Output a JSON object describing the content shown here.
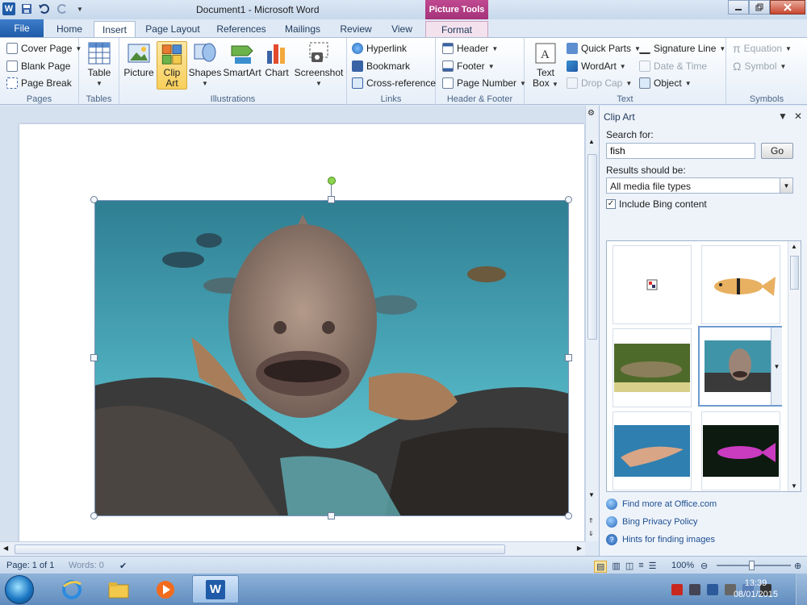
{
  "window": {
    "title": "Document1  -  Microsoft Word",
    "contextual_tab_group": "Picture Tools"
  },
  "tabs": [
    "File",
    "Home",
    "Insert",
    "Page Layout",
    "References",
    "Mailings",
    "Review",
    "View",
    "Format"
  ],
  "active_tab": "Insert",
  "ribbon": {
    "pages": {
      "label": "Pages",
      "items": [
        "Cover Page",
        "Blank Page",
        "Page Break"
      ]
    },
    "tables": {
      "label": "Tables",
      "table": "Table"
    },
    "illustrations": {
      "label": "Illustrations",
      "picture": "Picture",
      "clip_art_l1": "Clip",
      "clip_art_l2": "Art",
      "shapes": "Shapes",
      "smartart": "SmartArt",
      "chart": "Chart",
      "screenshot": "Screenshot"
    },
    "links": {
      "label": "Links",
      "items": [
        "Hyperlink",
        "Bookmark",
        "Cross-reference"
      ]
    },
    "header_footer": {
      "label": "Header & Footer",
      "items": [
        "Header",
        "Footer",
        "Page Number"
      ]
    },
    "text": {
      "label": "Text",
      "text_box_l1": "Text",
      "text_box_l2": "Box",
      "items": [
        "Quick Parts",
        "WordArt",
        "Drop Cap",
        "Signature Line",
        "Date & Time",
        "Object"
      ]
    },
    "symbols": {
      "label": "Symbols",
      "items": [
        "Equation",
        "Symbol"
      ]
    }
  },
  "clip_art_pane": {
    "title": "Clip Art",
    "search_label": "Search for:",
    "search_value": "fish",
    "go_label": "Go",
    "results_label": "Results should be:",
    "results_value": "All media file types",
    "include_bing": "Include Bing content",
    "include_bing_checked": true,
    "links": [
      "Find more at Office.com",
      "Bing Privacy Policy",
      "Hints for finding images"
    ]
  },
  "status": {
    "page": "Page: 1 of 1",
    "words": "Words: 0",
    "zoom": "100%"
  },
  "taskbar": {
    "time": "13:39",
    "date": "08/01/2015"
  },
  "colors": {
    "file_tab": "#1f5ba8",
    "picture_tools": "#a5327a",
    "selected_button": "#f8cf5a"
  }
}
